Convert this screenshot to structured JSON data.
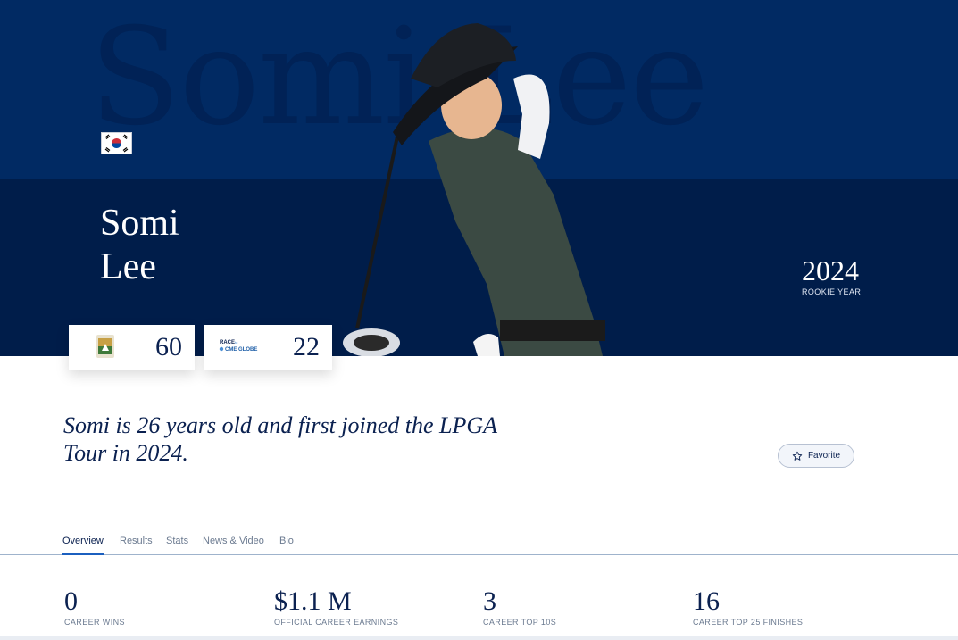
{
  "hero": {
    "watermark": "Somi Lee",
    "first_name": "Somi",
    "last_name": "Lee",
    "rookie_year": "2024",
    "rookie_label": "ROOKIE YEAR",
    "flag_icon": "south-korea-flag-icon"
  },
  "rankings": [
    {
      "logo": "rolex-rankings-icon",
      "value": "60"
    },
    {
      "logo": "race-to-cme-globe-icon",
      "logo_text_1": "RACE",
      "logo_text_2": "to",
      "logo_text_3": "CME GLOBE",
      "value": "22"
    }
  ],
  "intro": {
    "text": "Somi is 26 years old and first joined the LPGA Tour in 2024."
  },
  "favorite": {
    "label": "Favorite",
    "icon": "star-icon"
  },
  "tabs": [
    {
      "label": "Overview",
      "active": true
    },
    {
      "label": "Results"
    },
    {
      "label": "Stats"
    },
    {
      "label": "News & Video"
    },
    {
      "label": "Bio"
    }
  ],
  "stats": [
    {
      "value": "0",
      "label": "CAREER WINS"
    },
    {
      "value": "$1.1 M",
      "label": "OFFICIAL CAREER EARNINGS"
    },
    {
      "value": "3",
      "label": "CAREER TOP 10S"
    },
    {
      "value": "16",
      "label": "CAREER TOP 25 FINISHES"
    }
  ],
  "colors": {
    "hero_top": "#012a63",
    "hero_bottom": "#001d4a",
    "accent": "#1b5fbf",
    "text_dark": "#0b2150"
  }
}
